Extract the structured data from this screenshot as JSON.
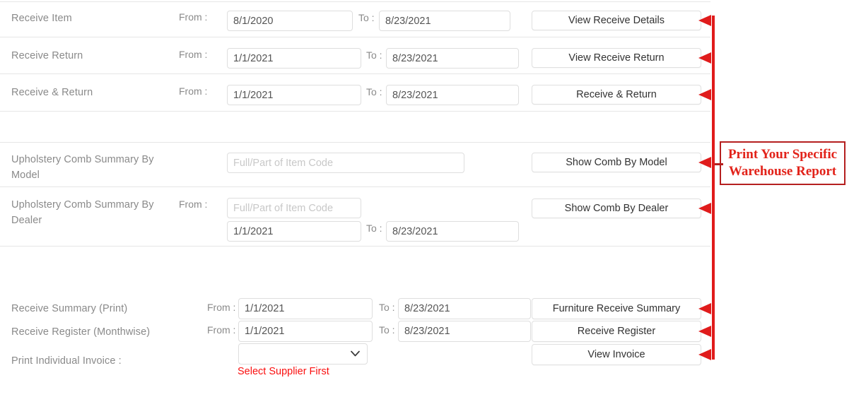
{
  "annotation": {
    "callout_text": "Print Your Specific\nWarehouse Report",
    "accent_color": "#e2231a",
    "line_color": "#e01b1b",
    "box_border_color": "#b51f1f"
  },
  "labels": {
    "from": "From :",
    "to": "To :",
    "to_short": "To :"
  },
  "placeholders": {
    "item_code": "Full/Part of Item Code"
  },
  "section_top": {
    "rows": [
      {
        "label": "Receive Item",
        "from_label": "From :",
        "from_value": "8/1/2020",
        "to_label": "To :",
        "to_value": "8/23/2021",
        "button": "View Receive Details"
      },
      {
        "label": "Receive Return",
        "from_label": "From :",
        "from_value": "1/1/2021",
        "to_label": "To :",
        "to_value": "8/23/2021",
        "button": "View Receive Return"
      },
      {
        "label": "Receive & Return",
        "from_label": "From :",
        "from_value": "1/1/2021",
        "to_label": "To :",
        "to_value": "8/23/2021",
        "button": "Receive & Return"
      }
    ]
  },
  "section_upholstery": {
    "rows": [
      {
        "label": "Upholstery Comb Summary By\nModel",
        "code_placeholder": "Full/Part of Item Code",
        "code_value": "",
        "button": "Show Comb By Model"
      },
      {
        "label": "Upholstery Comb Summary By\nDealer",
        "from_label": "From :",
        "code_placeholder": "Full/Part of Item Code",
        "code_value": "",
        "from_value": "1/1/2021",
        "to_label": "To :",
        "to_value": "8/23/2021",
        "button": "Show Comb By Dealer"
      }
    ]
  },
  "section_bottom": {
    "rows": [
      {
        "label": "Receive Summary (Print)",
        "from_label": "From :",
        "from_value": "1/1/2021",
        "to_label": "To :",
        "to_value": "8/23/2021",
        "button": "Furniture Receive Summary"
      },
      {
        "label": "Receive Register (Monthwise)",
        "from_label": "From :",
        "from_value": "1/1/2021",
        "to_label": "To :",
        "to_value": "8/23/2021",
        "button": "Receive Register"
      },
      {
        "label": "Print Individual Invoice :",
        "select_value": "",
        "select_options": [
          ""
        ],
        "note": "Select Supplier First",
        "button": "View Invoice"
      }
    ]
  },
  "icons": {
    "chevron_down": "⌄"
  }
}
